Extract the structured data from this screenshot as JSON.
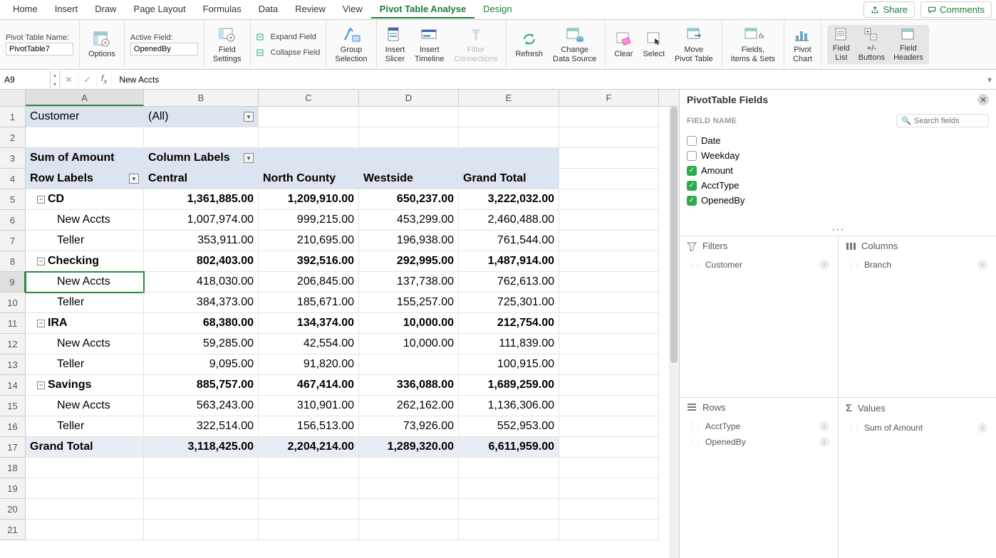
{
  "menu": {
    "items": [
      "Home",
      "Insert",
      "Draw",
      "Page Layout",
      "Formulas",
      "Data",
      "Review",
      "View",
      "Pivot Table Analyse",
      "Design"
    ],
    "active": 8,
    "design_idx": 9,
    "share": "Share",
    "comments": "Comments"
  },
  "ribbon": {
    "pt_name_label": "Pivot Table Name:",
    "pt_name": "PivotTable7",
    "options": "Options",
    "active_field_label": "Active Field:",
    "active_field": "OpenedBy",
    "field_settings": "Field\nSettings",
    "expand": "Expand Field",
    "collapse": "Collapse Field",
    "group_selection": "Group\nSelection",
    "insert_slicer": "Insert\nSlicer",
    "insert_timeline": "Insert\nTimeline",
    "filter_conn": "Filter\nConnections",
    "refresh": "Refresh",
    "change_src": "Change\nData Source",
    "clear": "Clear",
    "select": "Select",
    "move": "Move\nPivot Table",
    "fields_items": "Fields,\nItems & Sets",
    "pivot_chart": "Pivot\nChart",
    "field_list": "Field\nList",
    "pm_buttons": "+/-\nButtons",
    "field_headers": "Field\nHeaders"
  },
  "formula_bar": {
    "name": "A9",
    "value": "New Accts"
  },
  "columns": [
    "A",
    "B",
    "C",
    "D",
    "E",
    "F"
  ],
  "rows_count": 21,
  "selected_cell": {
    "row": 9,
    "col": "A"
  },
  "pivot": {
    "filter_label": "Customer",
    "filter_value": "(All)",
    "measure": "Sum of Amount",
    "col_label": "Column Labels",
    "row_label": "Row Labels",
    "col_headers": [
      "Central",
      "North County",
      "Westside",
      "Grand Total"
    ],
    "groups": [
      {
        "name": "CD",
        "totals": [
          "1,361,885.00",
          "1,209,910.00",
          "650,237.00",
          "3,222,032.00"
        ],
        "children": [
          {
            "name": "New Accts",
            "vals": [
              "1,007,974.00",
              "999,215.00",
              "453,299.00",
              "2,460,488.00"
            ]
          },
          {
            "name": "Teller",
            "vals": [
              "353,911.00",
              "210,695.00",
              "196,938.00",
              "761,544.00"
            ]
          }
        ]
      },
      {
        "name": "Checking",
        "totals": [
          "802,403.00",
          "392,516.00",
          "292,995.00",
          "1,487,914.00"
        ],
        "children": [
          {
            "name": "New Accts",
            "vals": [
              "418,030.00",
              "206,845.00",
              "137,738.00",
              "762,613.00"
            ]
          },
          {
            "name": "Teller",
            "vals": [
              "384,373.00",
              "185,671.00",
              "155,257.00",
              "725,301.00"
            ]
          }
        ]
      },
      {
        "name": "IRA",
        "totals": [
          "68,380.00",
          "134,374.00",
          "10,000.00",
          "212,754.00"
        ],
        "children": [
          {
            "name": "New Accts",
            "vals": [
              "59,285.00",
              "42,554.00",
              "10,000.00",
              "111,839.00"
            ]
          },
          {
            "name": "Teller",
            "vals": [
              "9,095.00",
              "91,820.00",
              "",
              "100,915.00"
            ]
          }
        ]
      },
      {
        "name": "Savings",
        "totals": [
          "885,757.00",
          "467,414.00",
          "336,088.00",
          "1,689,259.00"
        ],
        "children": [
          {
            "name": "New Accts",
            "vals": [
              "563,243.00",
              "310,901.00",
              "262,162.00",
              "1,136,306.00"
            ]
          },
          {
            "name": "Teller",
            "vals": [
              "322,514.00",
              "156,513.00",
              "73,926.00",
              "552,953.00"
            ]
          }
        ]
      }
    ],
    "grand_label": "Grand Total",
    "grand": [
      "3,118,425.00",
      "2,204,214.00",
      "1,289,320.00",
      "6,611,959.00"
    ]
  },
  "panel": {
    "title": "PivotTable Fields",
    "field_name_label": "FIELD NAME",
    "search_placeholder": "Search fields",
    "fields": [
      {
        "name": "Date",
        "checked": false
      },
      {
        "name": "Weekday",
        "checked": false
      },
      {
        "name": "Amount",
        "checked": true
      },
      {
        "name": "AcctType",
        "checked": true
      },
      {
        "name": "OpenedBy",
        "checked": true
      }
    ],
    "areas": {
      "filters": {
        "label": "Filters",
        "items": [
          "Customer"
        ]
      },
      "columns": {
        "label": "Columns",
        "items": [
          "Branch"
        ]
      },
      "rows": {
        "label": "Rows",
        "items": [
          "AcctType",
          "OpenedBy"
        ]
      },
      "values": {
        "label": "Values",
        "items": [
          "Sum of Amount"
        ]
      }
    }
  }
}
